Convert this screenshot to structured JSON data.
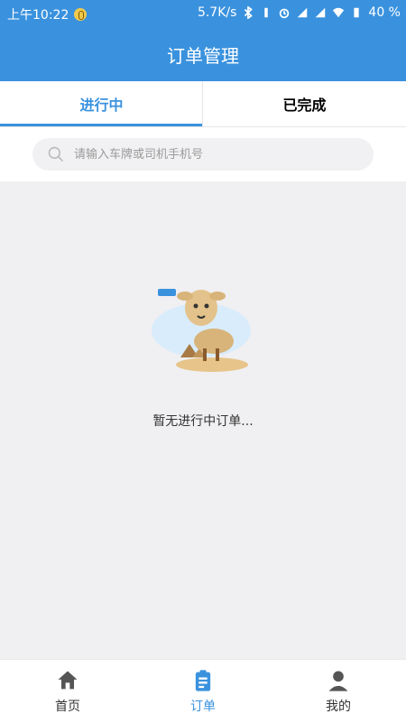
{
  "status_bar": {
    "time": "上午10:22",
    "speed": "5.7K/s",
    "battery": "40 %"
  },
  "header": {
    "title": "订单管理"
  },
  "tabs": [
    {
      "label": "进行中",
      "active": true
    },
    {
      "label": "已完成",
      "active": false
    }
  ],
  "search": {
    "placeholder": "请输入车牌或司机手机号"
  },
  "empty_state": {
    "text": "暂无进行中订单...",
    "illustration": "camel-desert-illustration"
  },
  "bottom_nav": [
    {
      "label": "首页",
      "icon": "home-icon"
    },
    {
      "label": "订单",
      "icon": "clipboard-icon",
      "active": true
    },
    {
      "label": "我的",
      "icon": "user-icon"
    }
  ],
  "colors": {
    "primary": "#3a92de",
    "background": "#f0eff2"
  }
}
